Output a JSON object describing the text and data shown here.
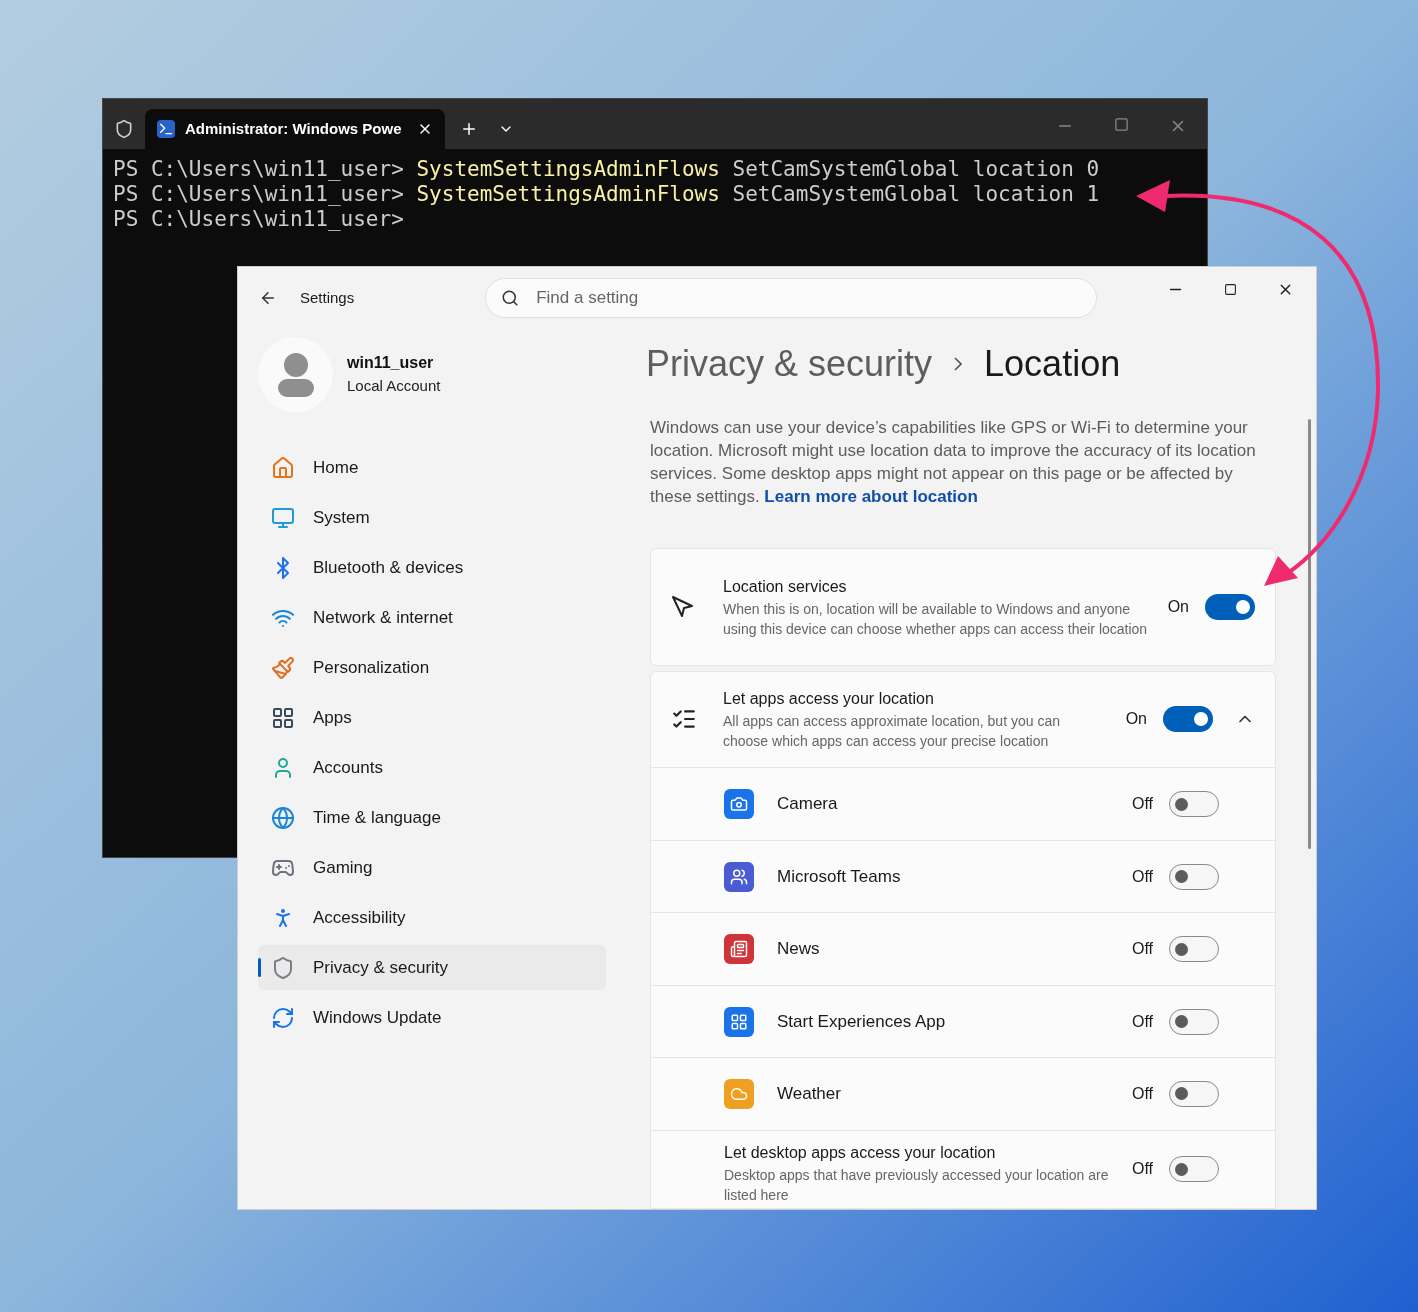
{
  "terminal": {
    "tab_title": "Administrator: Windows Powe",
    "lines": [
      {
        "prompt": "PS C:\\Users\\win11_user>",
        "command": "SystemSettingsAdminFlows",
        "args": "SetCamSystemGlobal location 0"
      },
      {
        "prompt": "PS C:\\Users\\win11_user>",
        "command": "SystemSettingsAdminFlows",
        "args": "SetCamSystemGlobal location 1"
      },
      {
        "prompt": "PS C:\\Users\\win11_user>"
      }
    ]
  },
  "settings": {
    "title": "Settings",
    "search": {
      "placeholder": "Find a setting"
    },
    "user": {
      "name": "win11_user",
      "account": "Local Account"
    },
    "nav": [
      {
        "label": "Home",
        "selected": false
      },
      {
        "label": "System",
        "selected": false
      },
      {
        "label": "Bluetooth & devices",
        "selected": false
      },
      {
        "label": "Network & internet",
        "selected": false
      },
      {
        "label": "Personalization",
        "selected": false
      },
      {
        "label": "Apps",
        "selected": false
      },
      {
        "label": "Accounts",
        "selected": false
      },
      {
        "label": "Time & language",
        "selected": false
      },
      {
        "label": "Gaming",
        "selected": false
      },
      {
        "label": "Accessibility",
        "selected": false
      },
      {
        "label": "Privacy & security",
        "selected": true
      },
      {
        "label": "Windows Update",
        "selected": false
      }
    ],
    "breadcrumb": {
      "parent": "Privacy & security",
      "current": "Location"
    },
    "description": "Windows can use your device’s capabilities like GPS or Wi-Fi to determine your location. Microsoft might use location data to improve the accuracy of its location services. Some desktop apps might not appear on this page or be affected by these settings.",
    "link": "Learn more about location",
    "location_services": {
      "title": "Location services",
      "description": "When this is on, location will be available to Windows and anyone using this device can choose whether apps can access their location",
      "state_label": "On",
      "on": true
    },
    "app_access": {
      "title": "Let apps access your location",
      "description": "All apps can access approximate location, but you can choose which apps can access your precise location",
      "state_label": "On",
      "on": true,
      "expanded": true,
      "apps": [
        {
          "name": "Camera",
          "state_label": "Off",
          "on": false
        },
        {
          "name": "Microsoft Teams",
          "state_label": "Off",
          "on": false
        },
        {
          "name": "News",
          "state_label": "Off",
          "on": false
        },
        {
          "name": "Start Experiences App",
          "state_label": "Off",
          "on": false
        },
        {
          "name": "Weather",
          "state_label": "Off",
          "on": false
        }
      ]
    },
    "desktop_apps": {
      "title": "Let desktop apps access your location",
      "description": "Desktop apps that have previously accessed your location are listed here",
      "state_label": "Off",
      "on": false
    }
  }
}
